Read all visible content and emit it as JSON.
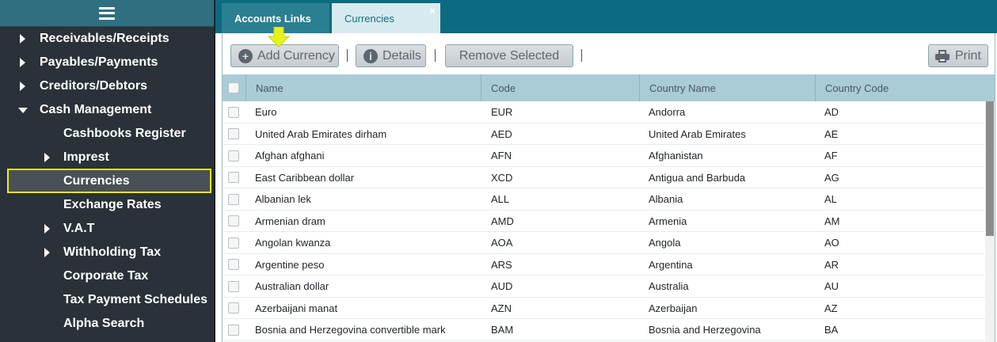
{
  "sidebar": {
    "items": [
      {
        "label": "Receivables/Receipts",
        "level": 0,
        "arrow": "right"
      },
      {
        "label": "Payables/Payments",
        "level": 0,
        "arrow": "right"
      },
      {
        "label": "Creditors/Debtors",
        "level": 0,
        "arrow": "right"
      },
      {
        "label": "Cash Management",
        "level": 0,
        "arrow": "down"
      },
      {
        "label": "Cashbooks Register",
        "level": 1,
        "arrow": ""
      },
      {
        "label": "Imprest",
        "level": 1,
        "arrow": "right"
      },
      {
        "label": "Currencies",
        "level": 1,
        "arrow": "",
        "selected": true
      },
      {
        "label": "Exchange Rates",
        "level": 1,
        "arrow": ""
      },
      {
        "label": "V.A.T",
        "level": 1,
        "arrow": "right"
      },
      {
        "label": "Withholding Tax",
        "level": 1,
        "arrow": "right"
      },
      {
        "label": "Corporate Tax",
        "level": 1,
        "arrow": ""
      },
      {
        "label": "Tax Payment Schedules",
        "level": 1,
        "arrow": ""
      },
      {
        "label": "Alpha Search",
        "level": 1,
        "arrow": ""
      }
    ],
    "icon": "hamburger-menu-icon"
  },
  "tabs": [
    {
      "label": "Accounts Links",
      "active": false
    },
    {
      "label": "Currencies",
      "active": true,
      "close": "×"
    }
  ],
  "toolbar": {
    "add_label": "Add Currency",
    "details_label": "Details",
    "remove_label": "Remove Selected",
    "print_label": "Print",
    "add_icon": "plus-circle-icon",
    "details_icon": "info-circle-icon",
    "print_icon": "printer-icon"
  },
  "grid": {
    "columns": [
      "Name",
      "Code",
      "Country Name",
      "Country Code"
    ],
    "rows": [
      [
        "Euro",
        "EUR",
        "Andorra",
        "AD"
      ],
      [
        "United Arab Emirates dirham",
        "AED",
        "United Arab Emirates",
        "AE"
      ],
      [
        "Afghan afghani",
        "AFN",
        "Afghanistan",
        "AF"
      ],
      [
        "East Caribbean dollar",
        "XCD",
        "Antigua and Barbuda",
        "AG"
      ],
      [
        "Albanian lek",
        "ALL",
        "Albania",
        "AL"
      ],
      [
        "Armenian dram",
        "AMD",
        "Armenia",
        "AM"
      ],
      [
        "Angolan kwanza",
        "AOA",
        "Angola",
        "AO"
      ],
      [
        "Argentine peso",
        "ARS",
        "Argentina",
        "AR"
      ],
      [
        "Australian dollar",
        "AUD",
        "Australia",
        "AU"
      ],
      [
        "Azerbaijani manat",
        "AZN",
        "Azerbaijan",
        "AZ"
      ],
      [
        "Bosnia and Herzegovina convertible mark",
        "BAM",
        "Bosnia and Herzegovina",
        "BA"
      ]
    ]
  },
  "colors": {
    "sidebar_bg": "#2b3138",
    "tabbar_bg": "#0b6b80",
    "header_bg": "#a9ccd6",
    "highlight": "#e6f21a"
  }
}
